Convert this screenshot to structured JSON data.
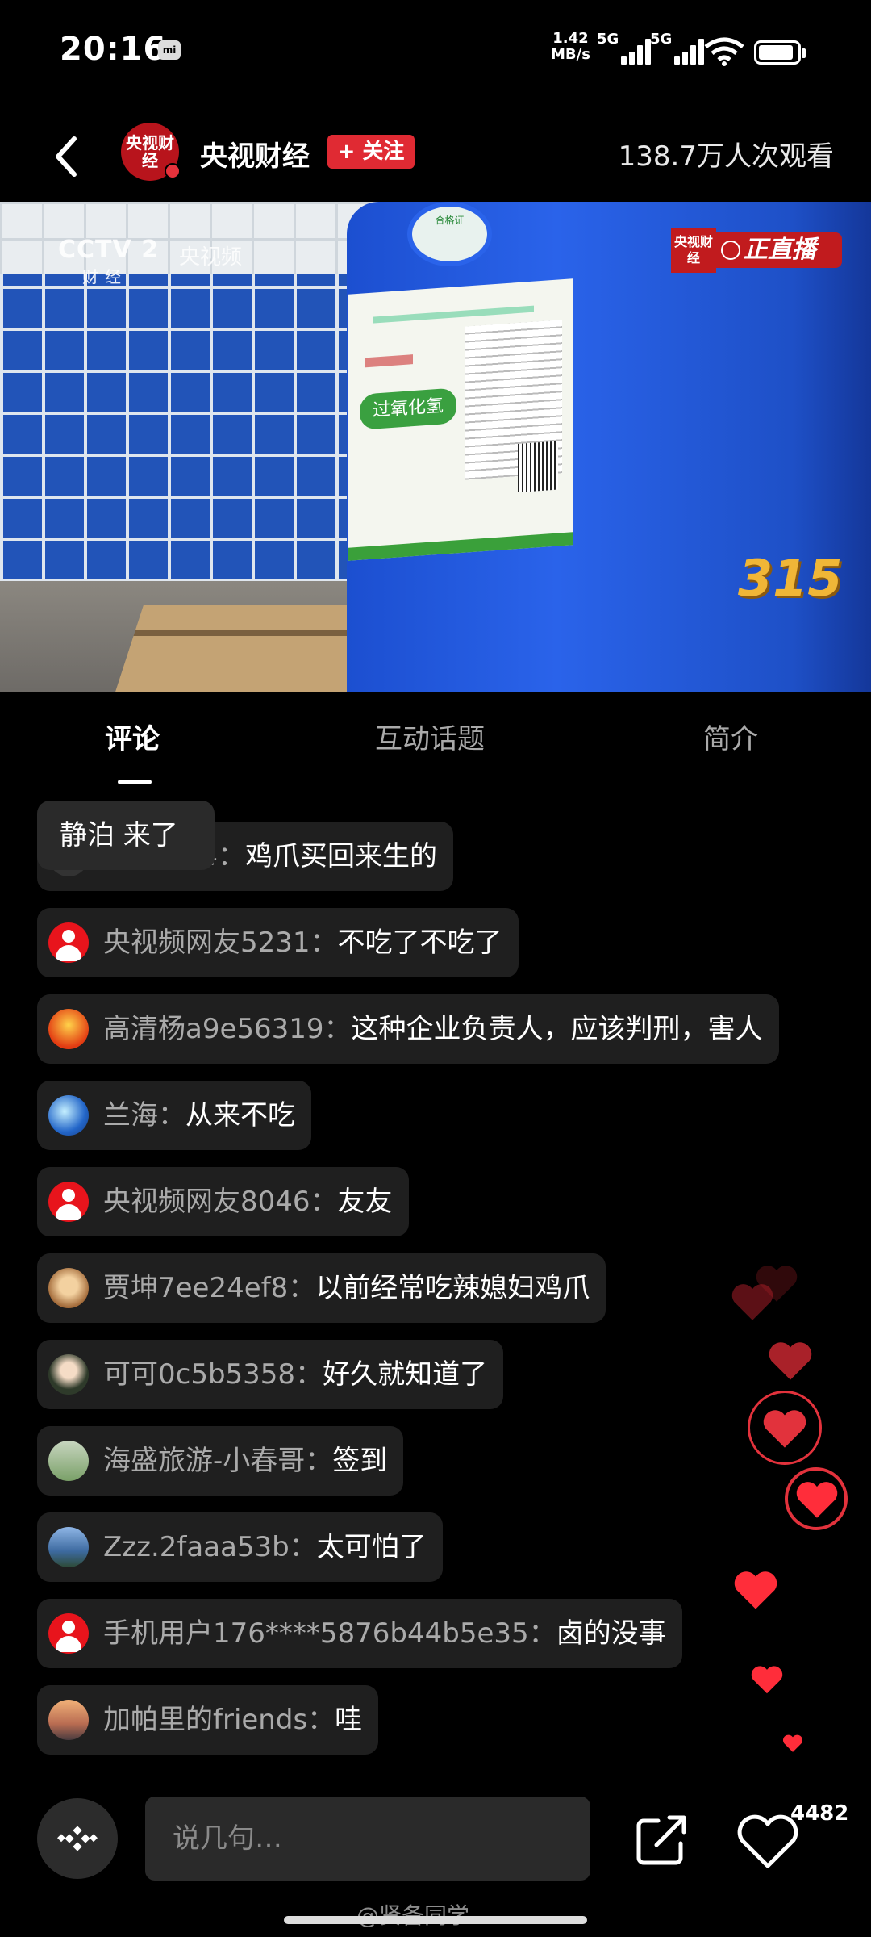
{
  "status_bar": {
    "time": "20:16",
    "net_speed_value": "1.42",
    "net_speed_unit": "MB/s",
    "sim1": "5G",
    "sim2": "5G",
    "battery_level": 0.85
  },
  "header": {
    "channel_avatar_text": "央视财经",
    "channel_name": "央视财经",
    "follow_label": "+ 关注",
    "viewers": "138.7万人次观看"
  },
  "video": {
    "cctv_logo": "CCTV 2",
    "cctv_sub": "财经",
    "cctv_video_label": "央视频",
    "live_badge_logo": "央视财经",
    "live_badge_text": "正直播",
    "corner_mark": "315"
  },
  "tabs": [
    {
      "label": "评论",
      "active": true
    },
    {
      "label": "互动话题",
      "active": false
    },
    {
      "label": "简介",
      "active": false
    }
  ],
  "join_toast": "静泊 来了",
  "comments": [
    {
      "user": "33e63e4",
      "message": "鸡爪买回来生的",
      "avatar": "dark"
    },
    {
      "user": "央视频网友5231",
      "message": "不吃了不吃了",
      "avatar": "red"
    },
    {
      "user": "高清杨a9e56319",
      "message": "这种企业负责人，应该判刑，害人",
      "avatar": "fire"
    },
    {
      "user": "兰海",
      "message": "从来不吃",
      "avatar": "earth"
    },
    {
      "user": "央视频网友8046",
      "message": "友友",
      "avatar": "red"
    },
    {
      "user": "贾坤7ee24ef8",
      "message": "以前经常吃辣媳妇鸡爪",
      "avatar": "face1"
    },
    {
      "user": "可可0c5b5358",
      "message": "好久就知道了",
      "avatar": "face2"
    },
    {
      "user": "海盛旅游-小春哥",
      "message": "签到",
      "avatar": "scene"
    },
    {
      "user": "Zzz.2faaa53b",
      "message": "太可怕了",
      "avatar": "sky"
    },
    {
      "user": "手机用户176****5876b44b5e35",
      "message": "卤的没事",
      "avatar": "red"
    },
    {
      "user": "加帕里的friends",
      "message": "哇",
      "avatar": "sunset"
    }
  ],
  "comment_separator": "：",
  "bottom_bar": {
    "input_placeholder": "说几句…",
    "like_count": "4482"
  },
  "watermark": "@贤备同学",
  "colors": {
    "accent_red": "#e02a33",
    "background": "#000000",
    "comment_bg": "#1f1f1f"
  }
}
